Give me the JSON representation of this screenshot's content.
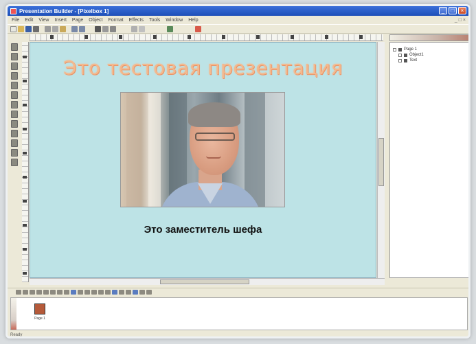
{
  "window": {
    "title": "Presentation Builder - [Pixelbox 1]",
    "minimize": "_",
    "maximize": "□",
    "close": "×"
  },
  "menu": {
    "items": [
      "File",
      "Edit",
      "View",
      "Insert",
      "Page",
      "Object",
      "Format",
      "Effects",
      "Tools",
      "Window",
      "Help"
    ],
    "mdi_controls": "_ □ ×"
  },
  "slide": {
    "title": "Это тестовая презентация",
    "caption": "Это заместитель шефа",
    "background": "#bde3e6",
    "title_color": "#f3b98e"
  },
  "object_tree": {
    "root": "Page 1",
    "children": [
      "Object1",
      "Text"
    ]
  },
  "thumbnails": [
    {
      "label": "Page 1"
    }
  ],
  "status": {
    "text": "Ready"
  },
  "icons": {
    "toolbar": [
      "new-icon",
      "open-icon",
      "save-icon",
      "print-icon",
      "cut-icon",
      "copy-icon",
      "paste-icon",
      "undo-icon",
      "redo-icon",
      "zoom-icon",
      "grid-icon",
      "align-icon",
      "text-icon",
      "image-icon",
      "shape-icon",
      "color-icon"
    ],
    "left_tools": [
      "pointer-icon",
      "text-tool-icon",
      "rectangle-icon",
      "ellipse-icon",
      "line-icon",
      "image-tool-icon",
      "table-icon",
      "chart-icon",
      "sound-icon",
      "video-icon",
      "link-icon",
      "zoom-tool-icon",
      "hand-icon"
    ]
  }
}
